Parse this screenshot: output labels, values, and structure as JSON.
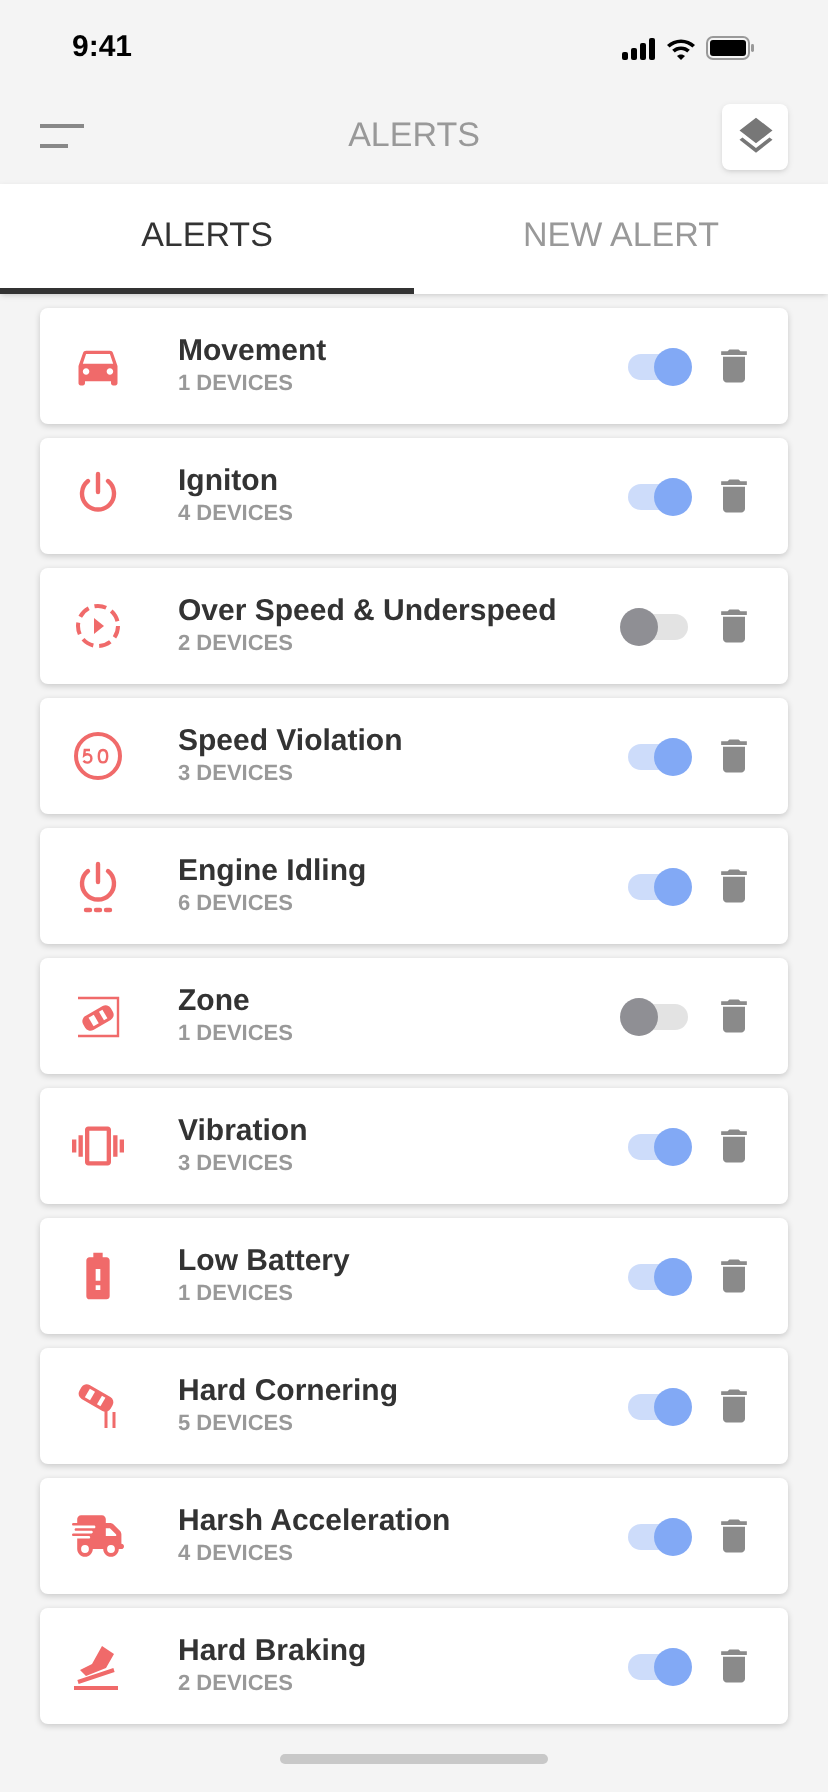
{
  "status_bar": {
    "time": "9:41"
  },
  "header": {
    "title": "ALERTS"
  },
  "tabs": [
    {
      "label": "ALERTS",
      "selected": true
    },
    {
      "label": "NEW ALERT",
      "selected": false
    }
  ],
  "alerts": [
    {
      "name": "Movement",
      "devices": "1 DEVICES",
      "on": true
    },
    {
      "name": "Igniton",
      "devices": "4 DEVICES",
      "on": true
    },
    {
      "name": "Over Speed & Underspeed",
      "devices": "2 DEVICES",
      "on": false
    },
    {
      "name": "Speed Violation",
      "devices": "3 DEVICES",
      "on": true
    },
    {
      "name": "Engine Idling",
      "devices": "6 DEVICES",
      "on": true
    },
    {
      "name": "Zone",
      "devices": "1 DEVICES",
      "on": false
    },
    {
      "name": "Vibration",
      "devices": "3 DEVICES",
      "on": true
    },
    {
      "name": "Low Battery",
      "devices": "1 DEVICES",
      "on": true
    },
    {
      "name": "Hard Cornering",
      "devices": "5 DEVICES",
      "on": true
    },
    {
      "name": "Harsh Acceleration",
      "devices": "4 DEVICES",
      "on": true
    },
    {
      "name": "Hard Braking",
      "devices": "2 DEVICES",
      "on": true
    }
  ]
}
